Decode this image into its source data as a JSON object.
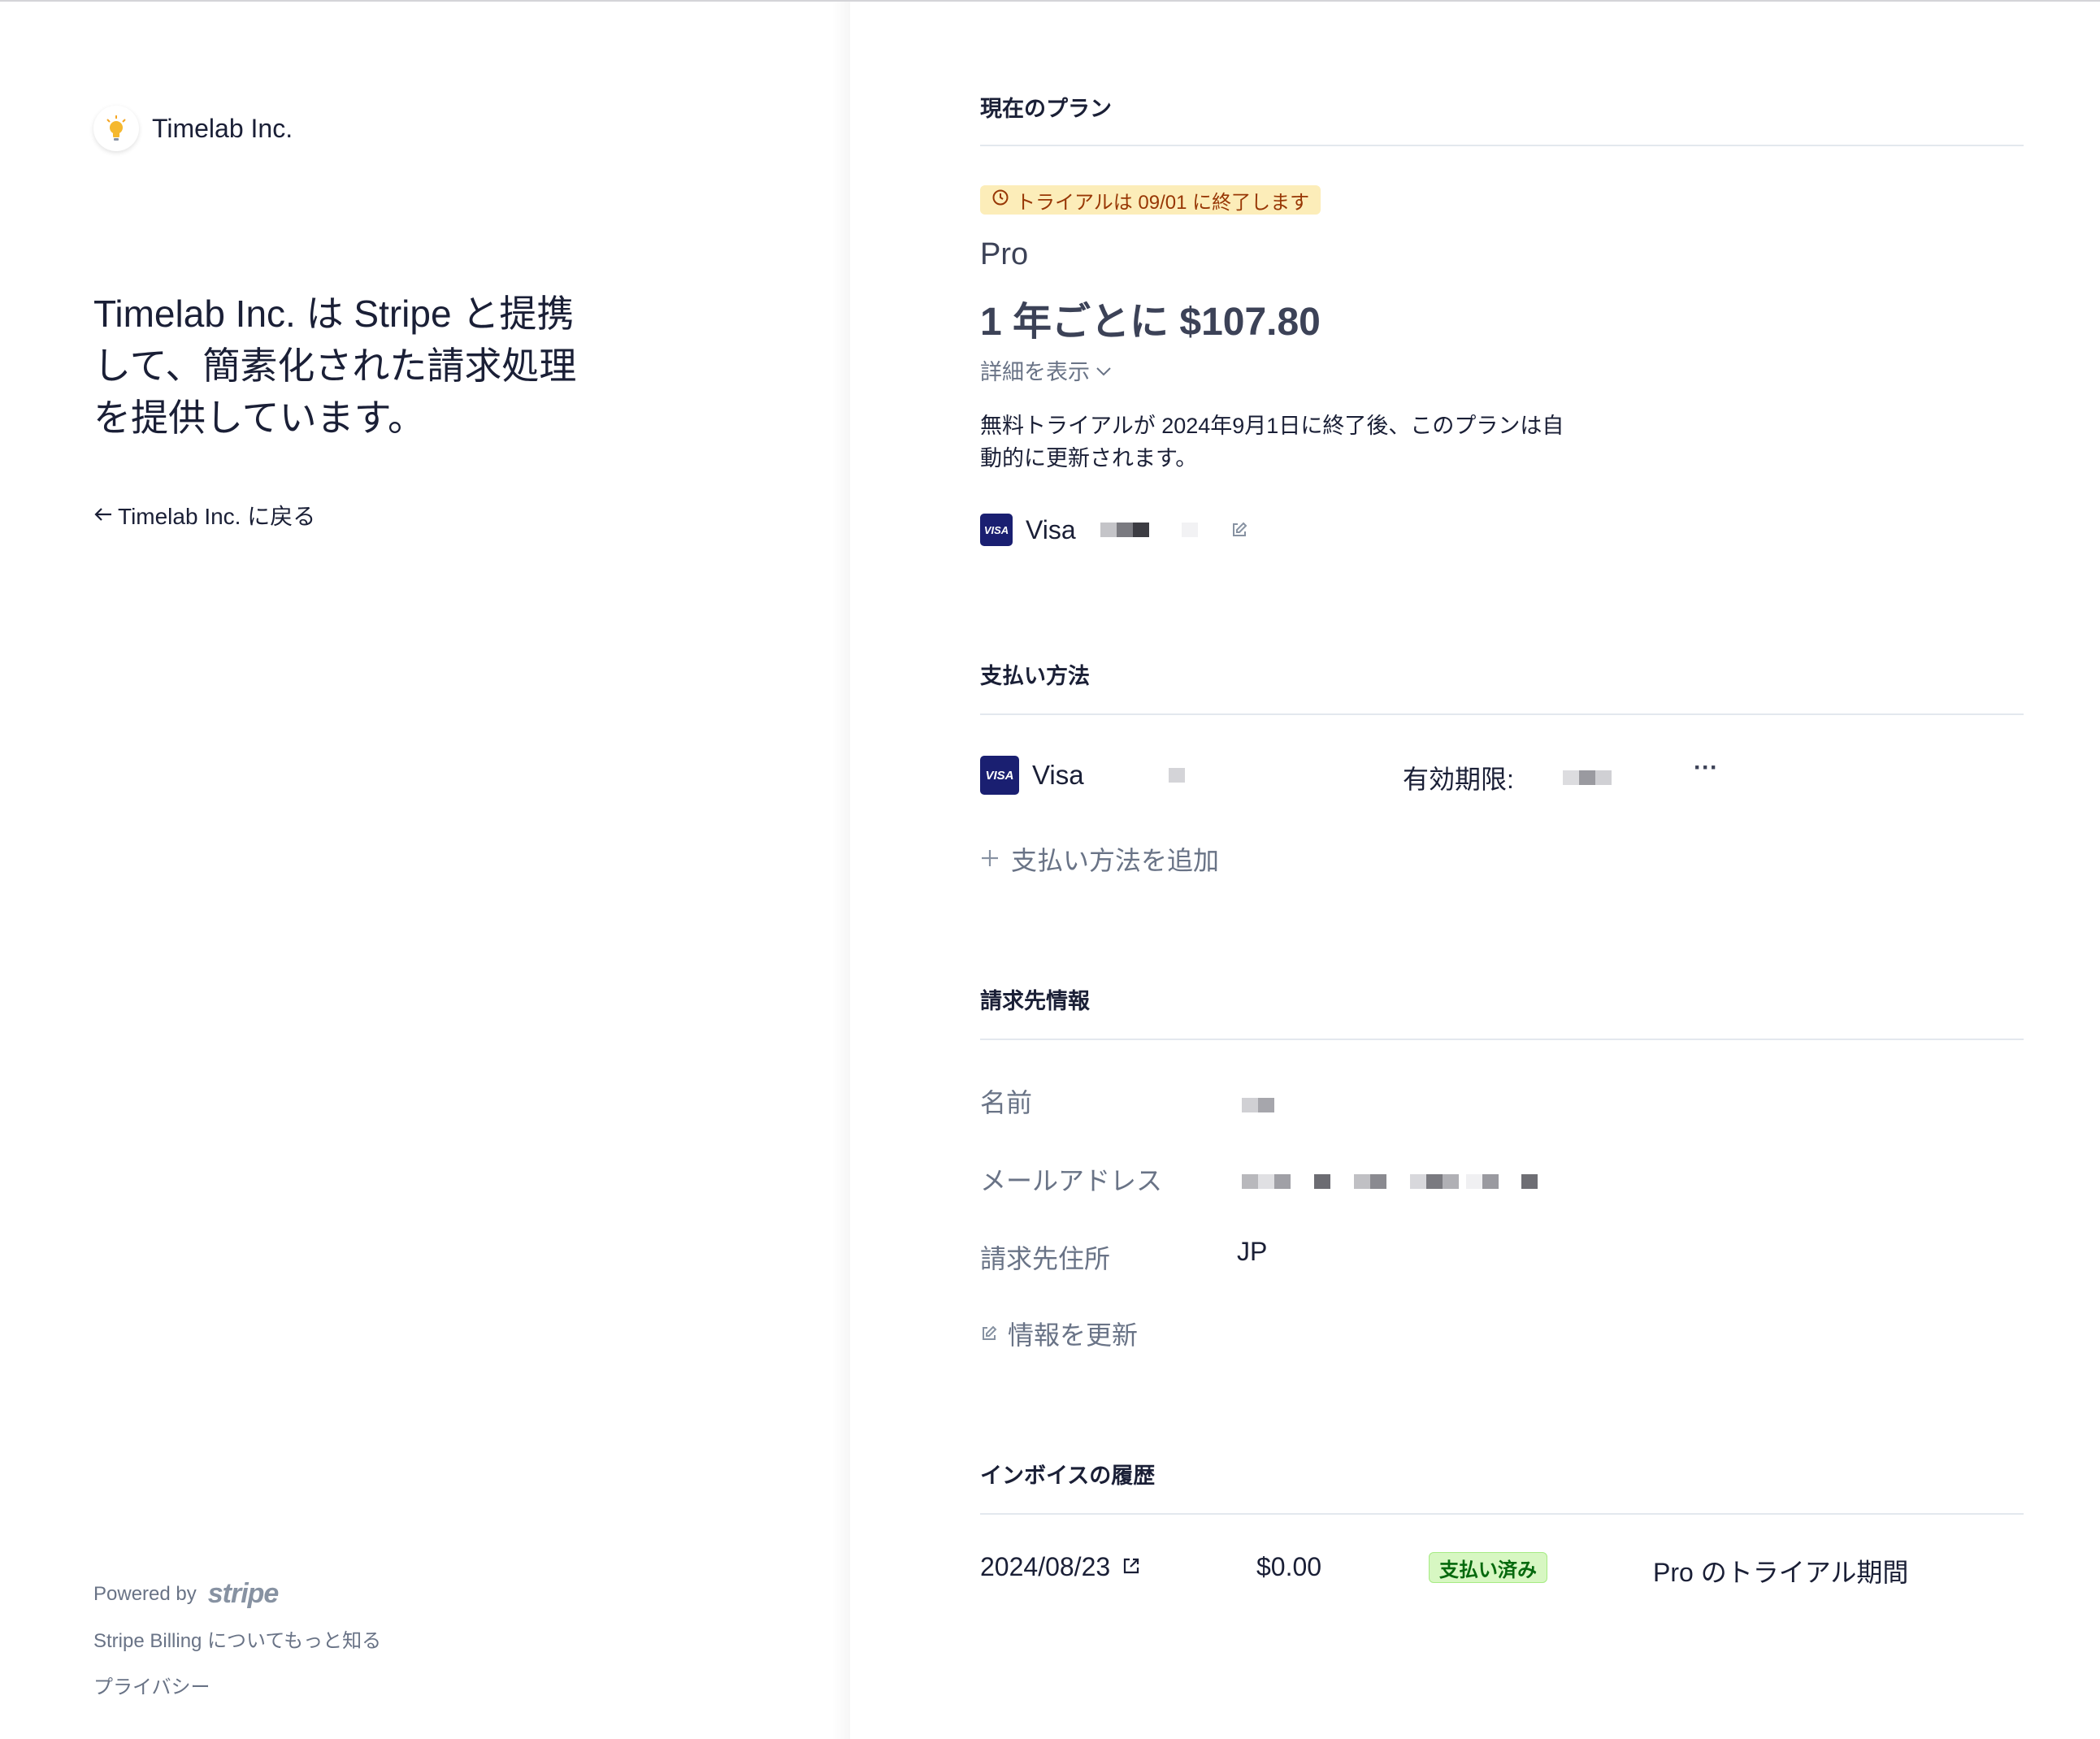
{
  "merchant": {
    "name": "Timelab Inc.",
    "tagline": "Timelab Inc. は Stripe と提携して、簡素化された請求処理を提供しています。",
    "back_link": "Timelab Inc. に戻る"
  },
  "footer": {
    "powered_by": "Powered by",
    "stripe_logo": "stripe",
    "learn_more": "Stripe Billing についてもっと知る",
    "privacy": "プライバシー"
  },
  "current_plan": {
    "section_title": "現在のプラン",
    "trial_badge": "トライアルは 09/01 に終了します",
    "plan_name": "Pro",
    "price": "1 年ごとに $107.80",
    "details_toggle": "詳細を表示",
    "description": "無料トライアルが 2024年9月1日に終了後、このプランは自動的に更新されます。",
    "card_brand": "Visa",
    "card_badge": "VISA"
  },
  "payment_methods": {
    "section_title": "支払い方法",
    "card_brand": "Visa",
    "card_badge": "VISA",
    "expiry_label": "有効期限: ",
    "more_label": "···",
    "add_method": "支払い方法を追加"
  },
  "billing_info": {
    "section_title": "請求先情報",
    "name_label": "名前",
    "email_label": "メールアドレス",
    "address_label": "請求先住所",
    "address_value": "JP",
    "update_label": "情報を更新"
  },
  "invoice_history": {
    "section_title": "インボイスの履歴",
    "rows": [
      {
        "date": "2024/08/23",
        "amount": "$0.00",
        "status": "支払い済み",
        "description": "Pro のトライアル期間"
      }
    ]
  },
  "colors": {
    "trial_badge_bg": "#fcedb9",
    "trial_badge_text": "#983705",
    "paid_badge_bg": "#d7f7c2",
    "paid_badge_text": "#05690d",
    "visa_blue": "#1a1f71",
    "muted_text": "#697386"
  }
}
